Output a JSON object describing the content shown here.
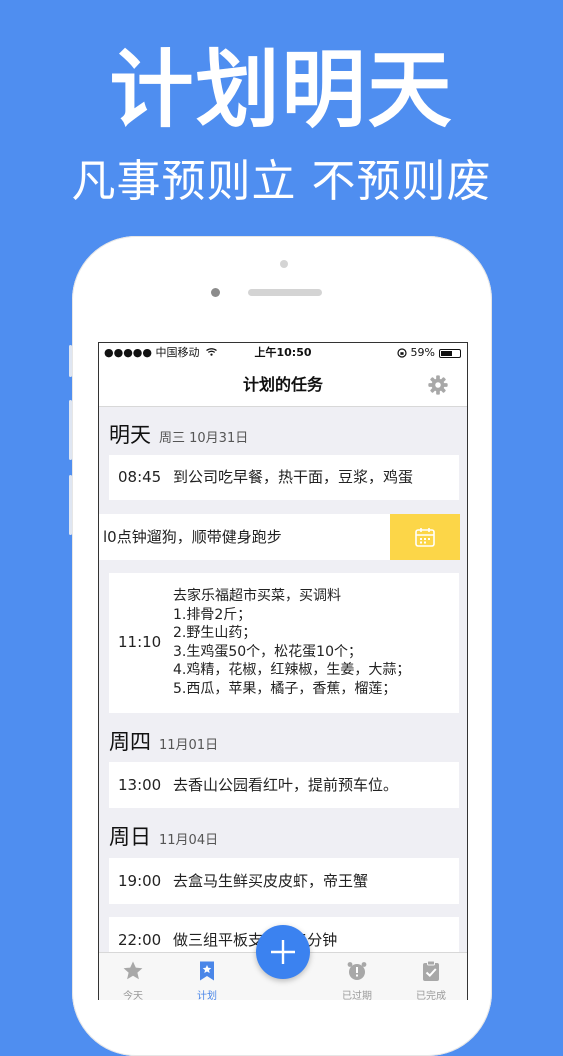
{
  "hero": {
    "title": "计划明天",
    "subtitle": "凡事预则立 不预则废"
  },
  "status_bar": {
    "carrier": "●●●●● 中国移动",
    "time": "上午10:50",
    "battery_text": "59%",
    "battery_level": 0.59
  },
  "nav": {
    "title": "计划的任务",
    "settings_icon": "gear-icon"
  },
  "sections": [
    {
      "day": "明天",
      "date": "周三  10月31日",
      "tasks": [
        {
          "time": "08:45",
          "text": "到公司吃早餐，热干面，豆浆，鸡蛋"
        },
        {
          "time": "",
          "text": "l0点钟遛狗，顺带健身跑步"
        },
        {
          "time": "11:10",
          "text": "去家乐福超市买菜，买调料\n1.排骨2斤；\n2.野生山药；\n3.生鸡蛋50个，松花蛋10个；\n4.鸡精，花椒，红辣椒，生姜，大蒜；\n5.西瓜，苹果，橘子，香蕉，榴莲；"
        }
      ]
    },
    {
      "day": "周四",
      "date": "11月01日",
      "tasks": [
        {
          "time": "13:00",
          "text": "去香山公园看红叶，提前预车位。"
        }
      ]
    },
    {
      "day": "周日",
      "date": "11月04日",
      "tasks": [
        {
          "time": "19:00",
          "text": "去盒马生鲜买皮皮虾，帝王蟹"
        },
        {
          "time": "22:00",
          "text": "做三组平板支     每组5分钟"
        }
      ]
    }
  ],
  "swipe_action": {
    "icon": "calendar-icon",
    "color": "#fcd648"
  },
  "tabs": [
    {
      "label": "今天",
      "icon": "star-icon"
    },
    {
      "label": "计划",
      "icon": "bookmark-icon",
      "active": true
    },
    {
      "label": "已过期",
      "icon": "alarm-clock-icon"
    },
    {
      "label": "已完成",
      "icon": "clipboard-check-icon"
    }
  ],
  "fab": {
    "icon": "plus-icon"
  },
  "colors": {
    "background": "#4f8ef0",
    "accent": "#3b82f0",
    "action_yellow": "#fcd648"
  }
}
